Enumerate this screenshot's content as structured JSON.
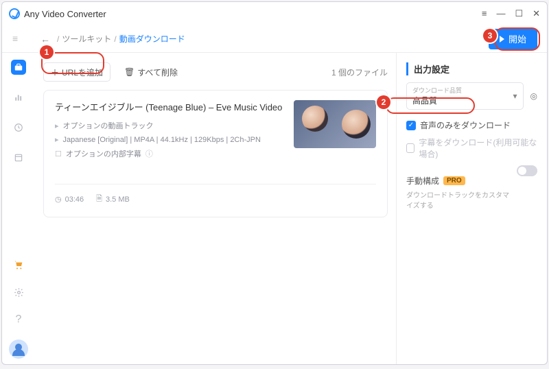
{
  "app": {
    "title": "Any Video Converter"
  },
  "toolbar": {
    "back_icon": "←",
    "crumb_root": "ツールキット",
    "crumb_current": "動画ダウンロード",
    "start_label": "開始"
  },
  "filetools": {
    "add_url_label": "URLを追加",
    "clear_all_label": "すべて削除",
    "file_count_label": "1 個のファイル"
  },
  "video": {
    "title": "ティーンエイジブルー (Teenage Blue) – Eve Music Video",
    "line_audio_track": "オプションの動画トラック",
    "line_format": "Japanese [Original] | MP4A | 44.1kHz | 129Kbps | 2Ch-JPN",
    "line_subs": "オプションの内部字幕",
    "duration": "03:46",
    "size": "3.5 MB"
  },
  "settings": {
    "header": "出力設定",
    "quality_label": "ダウンロード品質",
    "quality_value": "高品質",
    "audio_only_label": "音声のみをダウンロード",
    "subtitles_label": "字幕をダウンロード(利用可能な場合)",
    "manual_label": "手動構成",
    "manual_sub": "ダウンロードトラックをカスタマイズする",
    "pro_badge": "PRO"
  },
  "annotations": {
    "n1": "1",
    "n2": "2",
    "n3": "3"
  }
}
